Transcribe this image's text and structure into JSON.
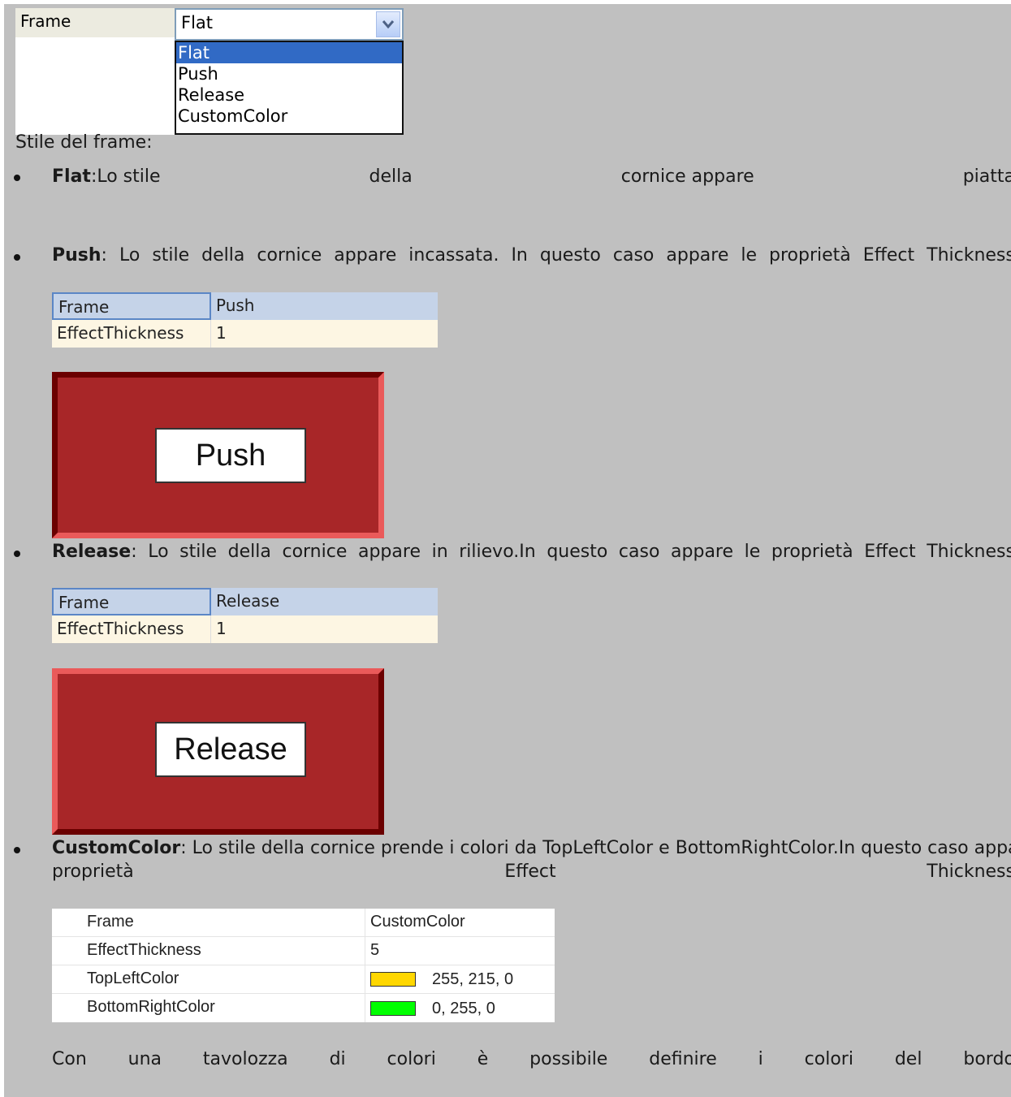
{
  "frame_combo": {
    "label": "Frame",
    "selected": "Flat",
    "options": [
      "Flat",
      "Push",
      "Release",
      "CustomColor"
    ],
    "icon": "chevron-down-icon"
  },
  "intro": "Stile del frame:",
  "flat": {
    "name": "Flat",
    "words": [
      ":Lo stile",
      "della",
      "cornice appare",
      "piatta"
    ]
  },
  "push": {
    "name": "Push",
    "words": [
      ":",
      "Lo",
      "stile",
      "della",
      "cornice",
      "appare",
      "incassata.",
      "In",
      "questo",
      "caso",
      "appare",
      "le",
      "proprietà",
      "Effect",
      "Thickness"
    ],
    "grid": {
      "rows": [
        [
          "Frame",
          "Push"
        ],
        [
          "EffectThickness",
          "1"
        ]
      ]
    },
    "button_label": "Push"
  },
  "release": {
    "name": "Release",
    "words": [
      ":",
      "Lo",
      "stile",
      "della",
      "cornice",
      "appare",
      "in",
      "rilievo.In",
      "questo",
      "caso",
      "appare",
      "le",
      "proprietà",
      "Effect",
      "Thickness"
    ],
    "grid": {
      "rows": [
        [
          "Frame",
          "Release"
        ],
        [
          "EffectThickness",
          "1"
        ]
      ]
    },
    "button_label": "Release"
  },
  "customcolor": {
    "name": "CustomColor",
    "line1": ": Lo stile della cornice prende i colori da TopLeftColor e BottomRightColor.In questo caso appare le",
    "line2_words": [
      "proprietà",
      "Effect",
      "Thickness"
    ],
    "grid": {
      "rows": [
        {
          "label": "Frame",
          "value": "CustomColor"
        },
        {
          "label": "EffectThickness",
          "value": "5"
        },
        {
          "label": "TopLeftColor",
          "value": "255, 215, 0",
          "swatch": "#ffd700"
        },
        {
          "label": "BottomRightColor",
          "value": "0, 255, 0",
          "swatch": "#00ff00"
        }
      ]
    }
  },
  "footer_words": [
    "Con",
    "una",
    "tavolozza",
    "di",
    "colori",
    "è",
    "possibile",
    "definire",
    "i",
    "colori",
    "del",
    "bordo"
  ],
  "colors": {
    "background": "#c0c0c0",
    "frame_fill": "#a82628",
    "dark_edge": "#6b0000",
    "light_edge": "#ea5a5a",
    "grid_header": "#c5d3e8",
    "grid_value_bg": "#fdf6e3",
    "selection": "#316ac5"
  }
}
